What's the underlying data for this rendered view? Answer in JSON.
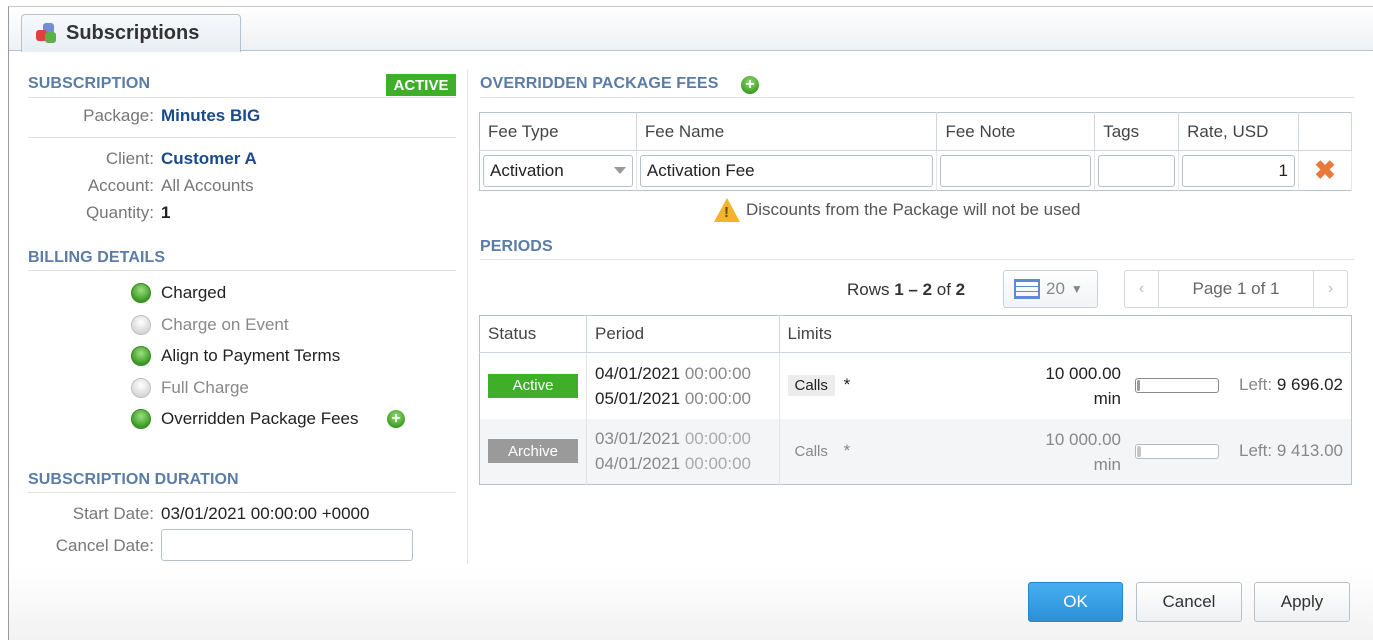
{
  "tab": {
    "title": "Subscriptions",
    "icon": "cubes-icon"
  },
  "subscription": {
    "section_title": "SUBSCRIPTION",
    "status_badge": "ACTIVE",
    "package_label": "Package:",
    "package_value": "Minutes BIG",
    "client_label": "Client:",
    "client_value": "Customer A",
    "account_label": "Account:",
    "account_value": "All Accounts",
    "quantity_label": "Quantity:",
    "quantity_value": "1"
  },
  "billing": {
    "section_title": "BILLING DETAILS",
    "items": [
      {
        "label": "Charged",
        "enabled": true
      },
      {
        "label": "Charge on Event",
        "enabled": false
      },
      {
        "label": "Align to Payment Terms",
        "enabled": true
      },
      {
        "label": "Full Charge",
        "enabled": false
      },
      {
        "label": "Overridden Package Fees",
        "enabled": true
      }
    ]
  },
  "duration": {
    "section_title": "SUBSCRIPTION DURATION",
    "start_label": "Start Date:",
    "start_value": "03/01/2021 00:00:00 +0000",
    "cancel_label": "Cancel Date:",
    "cancel_value": ""
  },
  "fees": {
    "section_title": "OVERRIDDEN PACKAGE FEES",
    "columns": [
      "Fee Type",
      "Fee Name",
      "Fee Note",
      "Tags",
      "Rate, USD"
    ],
    "rows": [
      {
        "fee_type": "Activation",
        "fee_name": "Activation Fee",
        "fee_note": "",
        "tags": "",
        "rate": "1"
      }
    ],
    "warning": "Discounts from the Package will not be used"
  },
  "periods": {
    "section_title": "PERIODS",
    "rows_prefix": "Rows ",
    "rows_range": "1 – 2",
    "rows_of": " of ",
    "rows_total": "2",
    "page_size": "20",
    "page_label": "Page 1 of 1",
    "prev": "‹",
    "next": "›",
    "columns": [
      "Status",
      "Period",
      "Limits"
    ],
    "rows": [
      {
        "status": "Active",
        "start_date": "04/01/2021",
        "start_time": "00:00:00",
        "end_date": "05/01/2021",
        "end_time": "00:00:00",
        "limit_tag": "Calls",
        "limit_star": "*",
        "limit_amount": "10 000.00",
        "limit_unit": "min",
        "left_label": "Left:",
        "left_value": "9 696.02",
        "used_fraction": 0.03
      },
      {
        "status": "Archive",
        "start_date": "03/01/2021",
        "start_time": "00:00:00",
        "end_date": "04/01/2021",
        "end_time": "00:00:00",
        "limit_tag": "Calls",
        "limit_star": "*",
        "limit_amount": "10 000.00",
        "limit_unit": "min",
        "left_label": "Left:",
        "left_value": "9 413.00",
        "used_fraction": 0.06
      }
    ]
  },
  "buttons": {
    "ok": "OK",
    "cancel": "Cancel",
    "apply": "Apply"
  },
  "colors": {
    "accent_green": "#3fae29",
    "section_blue": "#5a7ca6",
    "link_blue": "#1a4a8c",
    "ok_blue": "#2a90d8",
    "delete_orange": "#e8793a"
  }
}
